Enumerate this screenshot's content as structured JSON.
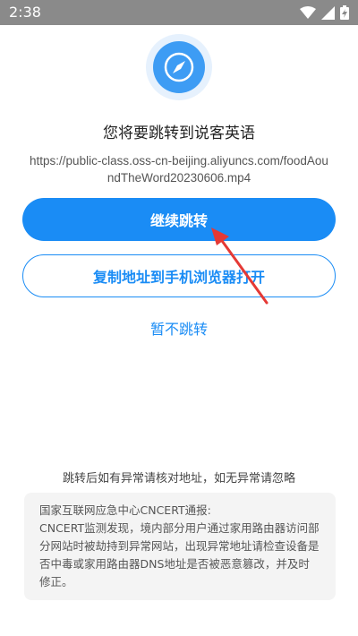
{
  "status_bar": {
    "time": "2:38",
    "icons": [
      "wifi-icon",
      "signal-icon",
      "battery-charging-icon"
    ]
  },
  "dialog": {
    "title": "您将要跳转到说客英语",
    "url": "https://public-class.oss-cn-beijing.aliyuncs.com/foodAoundTheWord20230606.mp4",
    "continue_label": "继续跳转",
    "copy_label": "复制地址到手机浏览器打开",
    "cancel_label": "暂不跳转",
    "hint": "跳转后如有异常请核对地址，如无异常请忽略",
    "notice_title": "国家互联网应急中心CNCERT通报:",
    "notice_body": " CNCERT监测发现，境内部分用户通过家用路由器访问部分网站时被劫持到异常网站，出现异常地址请检查设备是否中毒或家用路由器DNS地址是否被恶意篡改，并及时修正。"
  },
  "colors": {
    "accent": "#1a8cf5",
    "badge": "#3d9cf4",
    "badge_bg": "#e6f1fd",
    "annotation_arrow": "#e53935"
  },
  "icons": {
    "badge": "compass-icon",
    "annotation": "red-arrow-icon"
  }
}
